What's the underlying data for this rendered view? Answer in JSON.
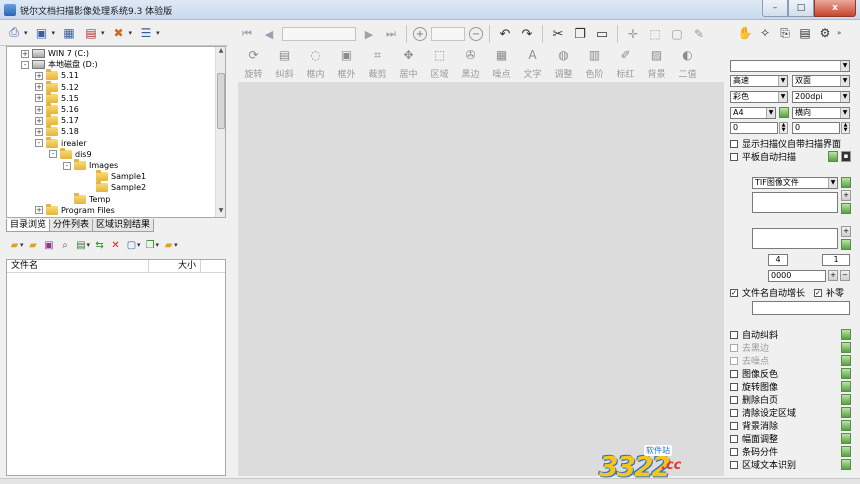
{
  "window": {
    "title": "锐尔文档扫描影像处理系统9.3 体验版",
    "controls": {
      "minimize": "–",
      "maximize": "□",
      "close": "x"
    }
  },
  "left_toolbar": {
    "icons": [
      "scanner-icon",
      "scan-settings-icon",
      "save-icon",
      "print-icon",
      "tools-icon",
      "list-icon"
    ]
  },
  "tree": {
    "items": [
      {
        "label": "WIN 7 (C:)",
        "type": "drive",
        "level": 1,
        "expander": "+"
      },
      {
        "label": "本地磁盘 (D:)",
        "type": "drive",
        "level": 1,
        "expander": "-"
      },
      {
        "label": "5.11",
        "type": "folder",
        "level": 2,
        "expander": "+"
      },
      {
        "label": "5.12",
        "type": "folder",
        "level": 2,
        "expander": "+"
      },
      {
        "label": "5.15",
        "type": "folder",
        "level": 2,
        "expander": "+"
      },
      {
        "label": "5.16",
        "type": "folder",
        "level": 2,
        "expander": "+"
      },
      {
        "label": "5.17",
        "type": "folder",
        "level": 2,
        "expander": "+"
      },
      {
        "label": "5.18",
        "type": "folder",
        "level": 2,
        "expander": "+"
      },
      {
        "label": "irealer",
        "type": "folder",
        "level": 2,
        "expander": "-"
      },
      {
        "label": "dis9",
        "type": "folder",
        "level": 3,
        "expander": "-"
      },
      {
        "label": "Images",
        "type": "folder",
        "level": 4,
        "expander": "-"
      },
      {
        "label": "Sample1",
        "type": "folder",
        "level": 5,
        "expander": ""
      },
      {
        "label": "Sample2",
        "type": "folder",
        "level": 5,
        "expander": ""
      },
      {
        "label": "Temp",
        "type": "folder",
        "level": 4,
        "expander": ""
      },
      {
        "label": "Program Files",
        "type": "folder",
        "level": 2,
        "expander": "+"
      }
    ]
  },
  "tabs": [
    "目录浏览",
    "分件列表",
    "区域识别结果"
  ],
  "file_list": {
    "columns": [
      "文件名",
      "大小"
    ]
  },
  "main_toolbar": {
    "tools": [
      "旋转",
      "纠斜",
      "框内",
      "框外",
      "裁剪",
      "居中",
      "区域",
      "黑边",
      "噪点",
      "文字",
      "调整",
      "色阶",
      "标红",
      "背景",
      "二值"
    ]
  },
  "right_panel": {
    "speed": "高速",
    "duplex": "双面",
    "color": "彩色",
    "dpi": "200dpi",
    "paper": "A4",
    "orientation": "横向",
    "offset_x": "0",
    "offset_y": "0",
    "show_scanner_ui": "显示扫描仪自带扫描界面",
    "flatbed_auto": "平板自动扫描",
    "file_format": "TIF图像文件",
    "digits": "4",
    "step": "1",
    "start_number": "0000",
    "auto_increment": "文件名自动增长",
    "pad_zero": "补零",
    "options": [
      {
        "label": "自动纠斜",
        "enabled": true
      },
      {
        "label": "去黑边",
        "enabled": false
      },
      {
        "label": "去噪点",
        "enabled": false
      },
      {
        "label": "图像反色",
        "enabled": true
      },
      {
        "label": "旋转图像",
        "enabled": true
      },
      {
        "label": "删除白页",
        "enabled": true
      },
      {
        "label": "清除设定区域",
        "enabled": true
      },
      {
        "label": "背景消除",
        "enabled": true
      },
      {
        "label": "幅面调整",
        "enabled": true
      },
      {
        "label": "条码分件",
        "enabled": true
      },
      {
        "label": "区域文本识别",
        "enabled": true
      }
    ]
  },
  "watermark": {
    "number": "3322",
    "suffix": ".cc",
    "tag": "软件站"
  }
}
